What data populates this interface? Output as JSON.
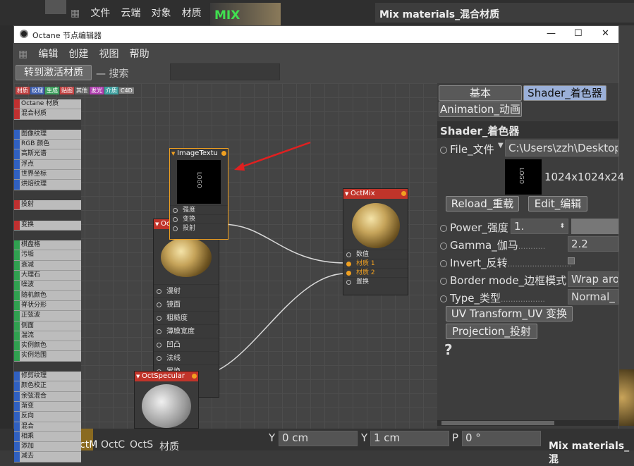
{
  "bg": {
    "menu": [
      "文件",
      "云端",
      "对象",
      "材质"
    ],
    "mix_thumb": "MIX",
    "mat_title": "Mix materials_混合材质",
    "bottom": {
      "y1": "Y",
      "v1": "0 cm",
      "y2": "Y",
      "v2": "1 cm",
      "p": "P",
      "v3": "0 °",
      "mats": [
        "OctM",
        "OctC",
        "OctS",
        "材质"
      ],
      "right_title": "Mix materials_混"
    }
  },
  "window": {
    "title": "Octane 节点编辑器",
    "controls": [
      "—",
      "☐",
      "✕"
    ]
  },
  "menu": [
    "编辑",
    "创建",
    "视图",
    "帮助"
  ],
  "toolbar": {
    "goto": "转到激活材质",
    "search_label": "搜索",
    "search_value": ""
  },
  "categories": [
    {
      "label": "材质",
      "color": "#c04040"
    },
    {
      "label": "纹理",
      "color": "#4060b0"
    },
    {
      "label": "生成",
      "color": "#40a060"
    },
    {
      "label": "贴图",
      "color": "#c04040"
    },
    {
      "label": "其他",
      "color": "#606060"
    },
    {
      "label": "发光",
      "color": "#b040b0"
    },
    {
      "label": "介质",
      "color": "#40a0a0"
    },
    {
      "label": "C4D",
      "color": "#808080"
    }
  ],
  "node_list": [
    {
      "label": "Octane 材质",
      "color": "#c03030"
    },
    {
      "label": "混合材质",
      "color": "#c03030"
    },
    {
      "label": "",
      "color": "#3a3a3a"
    },
    {
      "label": "图像纹理",
      "color": "#3060c0"
    },
    {
      "label": "RGB 颜色",
      "color": "#3060c0"
    },
    {
      "label": "高斯光谱",
      "color": "#3060c0"
    },
    {
      "label": "浮点",
      "color": "#3060c0"
    },
    {
      "label": "世界坐标",
      "color": "#3060c0"
    },
    {
      "label": "烘焙纹理",
      "color": "#3060c0"
    },
    {
      "label": "",
      "color": "#3a3a3a"
    },
    {
      "label": "投射",
      "color": "#c03030"
    },
    {
      "label": "",
      "color": "#3a3a3a"
    },
    {
      "label": "变换",
      "color": "#c03030"
    },
    {
      "label": "",
      "color": "#3a3a3a"
    },
    {
      "label": "棋盘格",
      "color": "#30a050"
    },
    {
      "label": "污垢",
      "color": "#30a050"
    },
    {
      "label": "衰减",
      "color": "#30a050"
    },
    {
      "label": "大理石",
      "color": "#30a050"
    },
    {
      "label": "噪波",
      "color": "#30a050"
    },
    {
      "label": "随机颜色",
      "color": "#30a050"
    },
    {
      "label": "脊状分形",
      "color": "#30a050"
    },
    {
      "label": "正弦波",
      "color": "#30a050"
    },
    {
      "label": "侧面",
      "color": "#30a050"
    },
    {
      "label": "湍流",
      "color": "#30a050"
    },
    {
      "label": "实例颜色",
      "color": "#30a050"
    },
    {
      "label": "实例范围",
      "color": "#30a050"
    },
    {
      "label": "",
      "color": "#3a3a3a"
    },
    {
      "label": "修剪纹理",
      "color": "#3060c0"
    },
    {
      "label": "颜色校正",
      "color": "#3060c0"
    },
    {
      "label": "余弦混合",
      "color": "#3060c0"
    },
    {
      "label": "渐变",
      "color": "#3060c0"
    },
    {
      "label": "反向",
      "color": "#3060c0"
    },
    {
      "label": "混合",
      "color": "#3060c0"
    },
    {
      "label": "相乘",
      "color": "#3060c0"
    },
    {
      "label": "添加",
      "color": "#3060c0"
    },
    {
      "label": "减去",
      "color": "#3060c0"
    }
  ],
  "nodes": {
    "image": {
      "title": "ImageTextu",
      "preview_text": "LOGO",
      "ports": [
        "强度",
        "变换",
        "投射"
      ]
    },
    "glossy": {
      "title": "Oc",
      "ports": [
        "漫射",
        "镜面",
        "粗糙度",
        "薄膜宽度",
        "凹凸",
        "法线",
        "置换"
      ]
    },
    "mix": {
      "title": "OctMix",
      "ports": [
        "数值",
        "材质 1",
        "材质 2",
        "置换"
      ]
    },
    "specular": {
      "title": "OctSpecular"
    }
  },
  "panel": {
    "tabs": [
      "基本",
      "Shader_着色器",
      "Animation_动画"
    ],
    "section": "Shader_着色器",
    "file_label": "File_文件",
    "file_path": "C:\\Users\\zzh\\Desktop\\",
    "thumb_text": "LOGO",
    "resolution": "1024x1024x24",
    "reload": "Reload_重载",
    "edit": "Edit_编辑",
    "power_label": "Power_强度",
    "power_value": "1.",
    "gamma_label": "Gamma_伽马",
    "gamma_value": "2.2",
    "invert_label": "Invert_反转",
    "border_label": "Border mode_边框模式",
    "border_value": "Wrap aro",
    "type_label": "Type_类型",
    "type_value": "Normal_",
    "uv_btn": "UV Transform_UV 变换",
    "proj_btn": "Projection_投射",
    "help": "?"
  },
  "colors": {
    "accent": "#f0a020",
    "node_header": "#c0342a",
    "arrow": "#e02020"
  }
}
